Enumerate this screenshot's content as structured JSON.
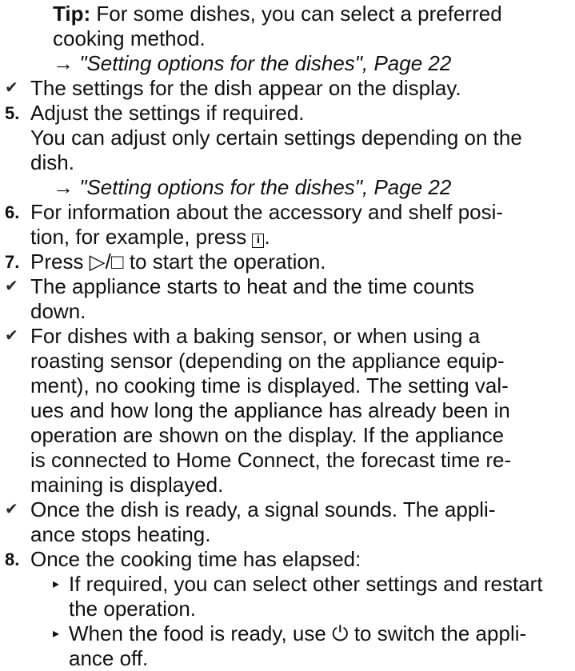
{
  "tip": {
    "label": "Tip:",
    "line1": " For some dishes, you can select a preferred",
    "line2": "cooking method.",
    "ref": "→ \"Setting options for the dishes\", Page 22"
  },
  "result1": "The settings for the dish appear on the display.",
  "step5": {
    "num": "5.",
    "text": "Adjust the settings if required.",
    "note1": "You can adjust only certain settings depending on the",
    "note2": "dish.",
    "ref": "→ \"Setting options for the dishes\", Page 22"
  },
  "step6": {
    "num": "6.",
    "line1": "For information about the accessory and shelf posi-",
    "line2a": "tion, for example, press ",
    "icon": "i",
    "line2b": "."
  },
  "step7": {
    "num": "7.",
    "text": "Press ▷/□ to start the operation."
  },
  "result2": {
    "line1": "The appliance starts to heat and the time counts",
    "line2": "down."
  },
  "result3": {
    "line1": "For dishes with a baking sensor, or when using a",
    "line2": "roasting sensor (depending on the appliance equip-",
    "line3": "ment), no cooking time is displayed. The setting val-",
    "line4": "ues and how long the appliance has already been in",
    "line5": "operation are shown on the display. If the appliance",
    "line6": "is connected to Home Connect, the forecast time re-",
    "line7": "maining is displayed."
  },
  "result4": {
    "line1": "Once the dish is ready, a signal sounds. The appli-",
    "line2": "ance stops heating."
  },
  "step8": {
    "num": "8.",
    "text": "Once the cooking time has elapsed:",
    "sub1": {
      "line1": "If required, you can select other settings and restart",
      "line2": "the operation."
    },
    "sub2": {
      "line1": "When the food is ready, use ⏻ to switch the appli-",
      "line2": "ance off."
    }
  },
  "symbols": {
    "check": "✔",
    "triangle": "▸"
  }
}
